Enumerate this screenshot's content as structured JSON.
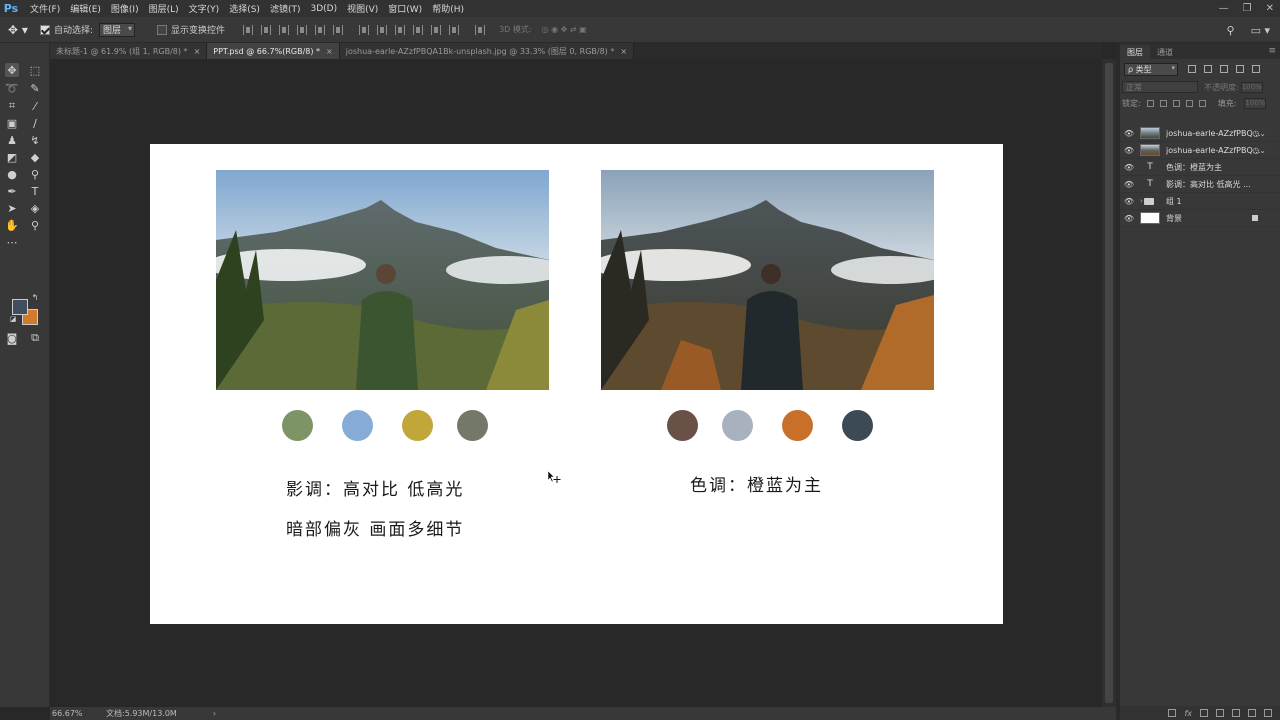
{
  "menubar": {
    "logo": "Ps",
    "items": [
      "文件(F)",
      "编辑(E)",
      "图像(I)",
      "图层(L)",
      "文字(Y)",
      "选择(S)",
      "滤镜(T)",
      "3D(D)",
      "视图(V)",
      "窗口(W)",
      "帮助(H)"
    ],
    "win_min": "—",
    "win_restore": "❐",
    "win_close": "✕"
  },
  "options": {
    "auto_select_label": "自动选择:",
    "auto_select_value": "图层",
    "show_transform_label": "显示变换控件",
    "mode_3d_label": "3D 模式:"
  },
  "tabs": [
    {
      "label": "未标题-1 @ 61.9% (组 1, RGB/8) *",
      "active": false
    },
    {
      "label": "PPT.psd @ 66.7%(RGB/8) *",
      "active": true
    },
    {
      "label": "joshua-earle-AZzfPBQA1Bk-unsplash.jpg @ 33.3% (图层 0, RGB/8) *",
      "active": false
    }
  ],
  "tools": {
    "foreground_color": "#3e4e5c",
    "background_color": "#d27a2c"
  },
  "artboard": {
    "left_palette": [
      "#7d9466",
      "#86abd5",
      "#c1a63a",
      "#737868"
    ],
    "right_palette": [
      "#6a5148",
      "#a8b2be",
      "#c8702a",
      "#3c4a55"
    ],
    "left_caption_line1": "影调：高对比 低高光",
    "left_caption_line2": "暗部偏灰 画面多细节",
    "right_caption": "色调：橙蓝为主"
  },
  "status": {
    "zoom": "66.67%",
    "doc": "文档:5.93M/13.0M",
    "arrow": "›"
  },
  "layers_panel": {
    "tab_layers": "图层",
    "tab_channels": "通道",
    "filter_label": "ρ 类型",
    "blend_mode": "正常",
    "opacity_label": "不透明度:",
    "opacity_value": "100%",
    "lock_label": "锁定:",
    "fill_label": "填充:",
    "fill_value": "100%",
    "layers": [
      {
        "name": "joshua-earle-AZzfPBQ...",
        "kind": "smart-photo"
      },
      {
        "name": "joshua-earle-AZzfPBQ...",
        "kind": "smart-photo2"
      },
      {
        "name": "色调：橙蓝为主",
        "kind": "text"
      },
      {
        "name": "影调：高对比 低高光 ...",
        "kind": "text"
      },
      {
        "name": "组 1",
        "kind": "group"
      },
      {
        "name": "背景",
        "kind": "background"
      }
    ]
  }
}
